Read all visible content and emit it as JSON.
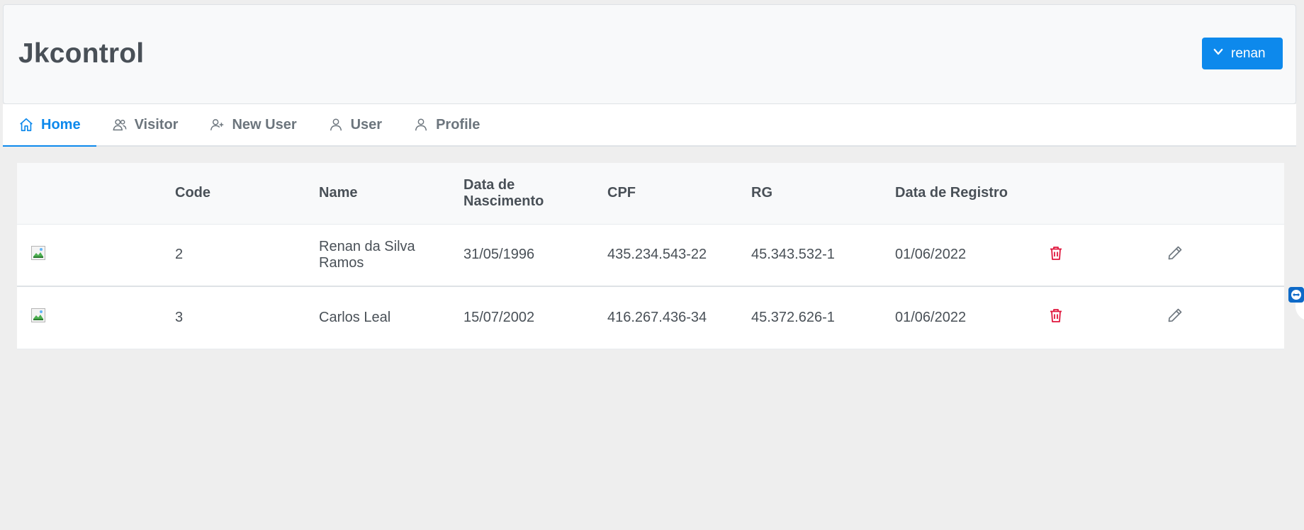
{
  "app": {
    "title": "Jkcontrol"
  },
  "user_menu": {
    "label": "renan",
    "icon": "chevron-down-icon"
  },
  "tabs": [
    {
      "label": "Home",
      "icon": "home-icon",
      "active": true
    },
    {
      "label": "Visitor",
      "icon": "users-icon",
      "active": false
    },
    {
      "label": "New User",
      "icon": "user-plus-icon",
      "active": false
    },
    {
      "label": "User",
      "icon": "user-icon",
      "active": false
    },
    {
      "label": "Profile",
      "icon": "user-icon",
      "active": false
    }
  ],
  "table": {
    "columns": [
      "",
      "Code",
      "Name",
      "Data de Nascimento",
      "CPF",
      "RG",
      "Data de Registro",
      "",
      ""
    ],
    "rows": [
      {
        "code": "2",
        "name": "Renan da Silva Ramos",
        "birth": "31/05/1996",
        "cpf": "435.234.543-22",
        "rg": "45.343.532-1",
        "registered": "01/06/2022"
      },
      {
        "code": "3",
        "name": "Carlos Leal",
        "birth": "15/07/2002",
        "cpf": "416.267.436-34",
        "rg": "45.372.626-1",
        "registered": "01/06/2022"
      }
    ]
  },
  "colors": {
    "primary": "#0d89ec",
    "danger": "#e0163d",
    "text": "#495057",
    "muted": "#6c757d"
  }
}
